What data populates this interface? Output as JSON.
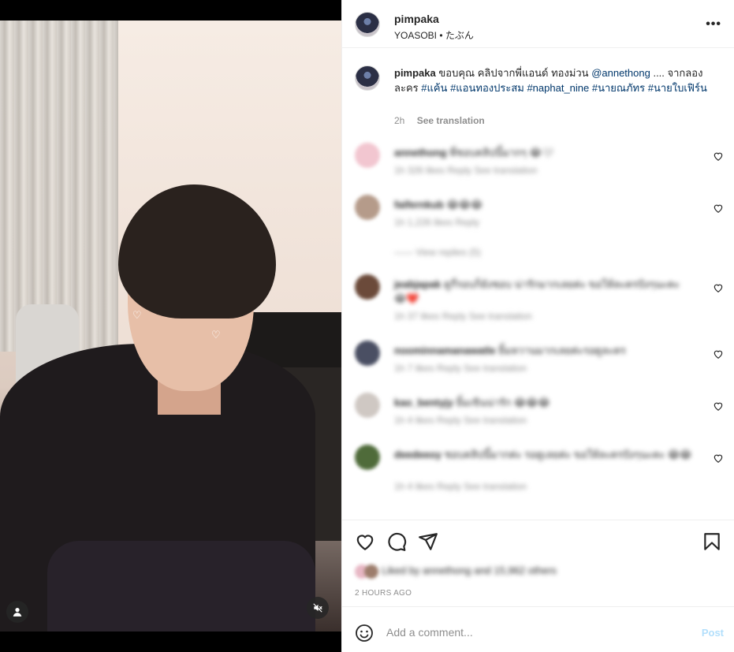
{
  "header": {
    "username": "pimpaka",
    "music": "YOASOBI • たぶん"
  },
  "caption": {
    "username": "pimpaka",
    "text_plain": "ขอบคุณ คลิปจากพี่แอนด์ ทองม่วน ",
    "mention": "@annethong",
    "text_after": " .... จากลองละคร ",
    "hashtags": [
      "#แค้น",
      "#แอนทองประสม",
      "#naphat_nine",
      "#นายณภัทร",
      "#นายใบเฟิร์น"
    ],
    "time": "2h",
    "see_translation": "See translation"
  },
  "comments": [
    {
      "user": "annethong",
      "text": "พี่ชอบคลิปนี้มากๆ 😂🤍",
      "meta": "1h   326 likes   Reply   See translation",
      "avatar_color": "#f2c6d0"
    },
    {
      "user": "faifernkub",
      "text": "😂😂😂",
      "meta": "1h   1,226 likes   Reply",
      "avatar_color": "#b59b8a"
    },
    {
      "user": "jeabjapak",
      "text": "ดูกี่รอบก็ยังชอบ น่ารักมากเลยค่ะ ขอให้ละครปังๆนะคะ 😂❤️",
      "meta": "1h   37 likes   Reply   See translation",
      "avatar_color": "#6b4a3a"
    },
    {
      "user": "noominnamanawatle",
      "text": "ยิ้มหวานมากเลยค่ะรอดูละคร",
      "meta": "1h   7 likes   Reply   See translation",
      "avatar_color": "#4a4f63"
    },
    {
      "user": "kao_bentyjy",
      "text": "ยิ้มเขินน่ารัก 😂😂😂",
      "meta": "1h   4 likes   Reply   See translation",
      "avatar_color": "#cfc8c3"
    },
    {
      "user": "deedeeoy",
      "text": "ชอบคลิปนี้มากค่ะ รอดูเลยค่ะ ขอให้ละครปังๆนะคะ 😂😂",
      "meta": "1h   4 likes   Reply   See translation",
      "avatar_color": "#4f6b3a"
    }
  ],
  "view_replies": "View replies (5)",
  "likes_text": "Liked by annethong and 15,962 others",
  "time_ago": "2 HOURS AGO",
  "add_comment": {
    "placeholder": "Add a comment...",
    "post_label": "Post"
  },
  "icons": {
    "more": "more-options-icon",
    "heart": "heart-icon",
    "comment": "comment-icon",
    "share": "share-icon",
    "save": "bookmark-icon",
    "emoji": "emoji-icon",
    "tags": "user-tag-icon",
    "mute": "muted-audio-icon"
  },
  "colors": {
    "link": "#00376b",
    "muted": "#8e8e8e",
    "post_disabled": "#b2dffc"
  }
}
